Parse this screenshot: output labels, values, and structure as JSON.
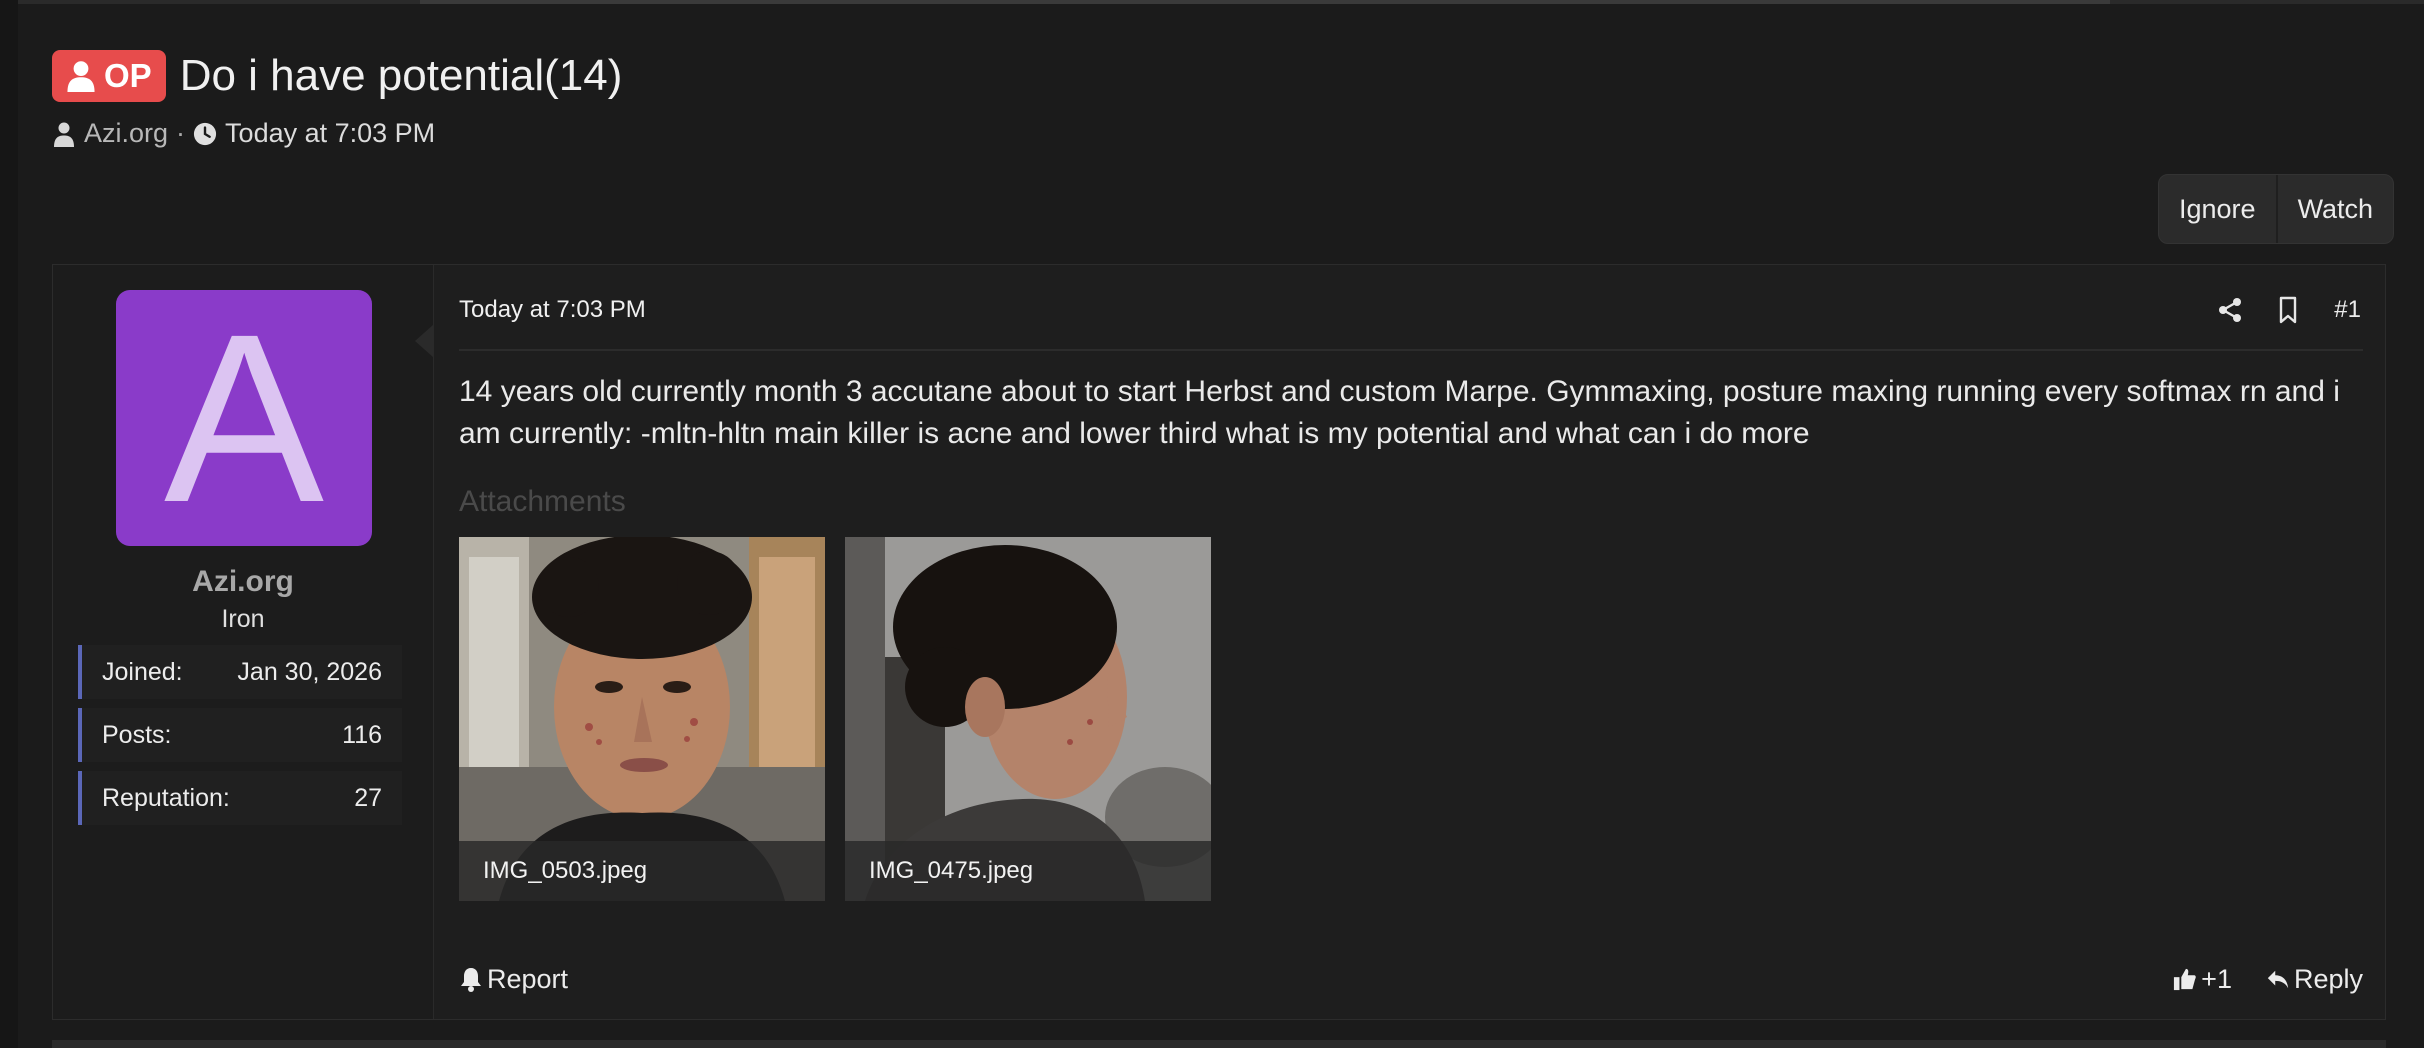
{
  "thread": {
    "badge": "OP",
    "title": "Do i have potential(14)",
    "author": "Azi.org",
    "separator": "·",
    "time": "Today at 7:03 PM"
  },
  "thread_actions": {
    "ignore": "Ignore",
    "watch": "Watch"
  },
  "post": {
    "user": {
      "avatar_letter": "A",
      "avatar_color": "#8a3bc9",
      "name": "Azi.org",
      "title": "Iron",
      "stats": [
        {
          "label": "Joined:",
          "value": "Jan 30, 2026"
        },
        {
          "label": "Posts:",
          "value": "116"
        },
        {
          "label": "Reputation:",
          "value": "27"
        }
      ]
    },
    "date": "Today at 7:03 PM",
    "number": "#1",
    "body": "14 years old currently month 3 accutane about to start Herbst and custom Marpe. Gymmaxing, posture maxing running every softmax rn and i am currently: -mltn-hltn main killer is acne and lower third what is my potential and what can i do more",
    "attachments_label": "Attachments",
    "attachments": [
      {
        "filename": "IMG_0503.jpeg"
      },
      {
        "filename": "IMG_0475.jpeg"
      }
    ],
    "footer": {
      "report": "Report",
      "reaction": "+1",
      "reply": "Reply"
    }
  },
  "colors": {
    "op_badge": "#e74c4c",
    "stat_accent": "#5b67b8",
    "background": "#1b1b1b"
  }
}
